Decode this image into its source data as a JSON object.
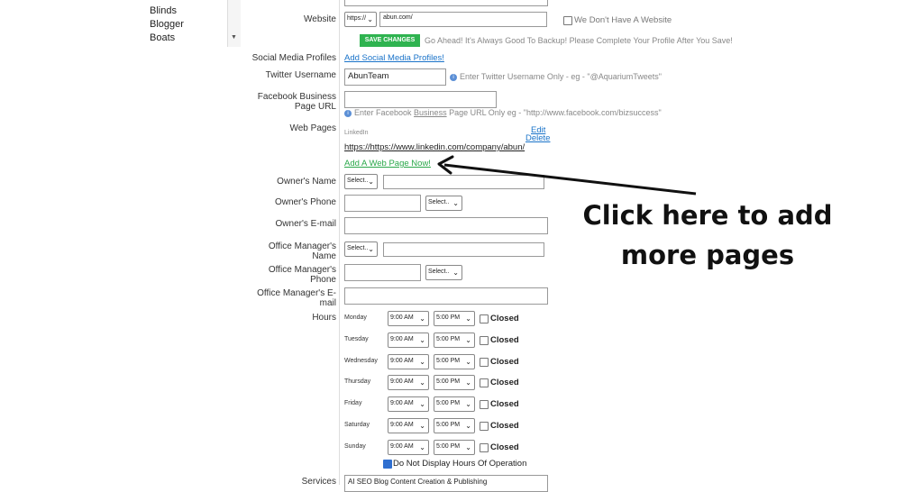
{
  "sidebar": {
    "items": [
      "Blinds",
      "Blogger",
      "Boats"
    ]
  },
  "form": {
    "website": {
      "label": "Website",
      "protocol": "https://",
      "value": "abun.com/",
      "no_website": "We Don't Have A Website"
    },
    "save": {
      "label": "SAVE CHANGES",
      "note": "Go Ahead!  It's Always Good To Backup!  Please Complete Your Profile After You Save!"
    },
    "social": {
      "label": "Social Media Profiles",
      "link": "Add Social Media Profiles!"
    },
    "twitter": {
      "label": "Twitter Username",
      "value": "AbunTeam",
      "hint": "Enter Twitter Username Only - eg - \"@AquariumTweets\""
    },
    "facebook": {
      "label_line1": "Facebook Business",
      "label_line2": "Page URL",
      "value": "",
      "hint_pre": "Enter Facebook ",
      "hint_u": "Business",
      "hint_post": " Page URL Only eg - \"http://www.facebook.com/bizsuccess\""
    },
    "web_pages": {
      "label": "Web Pages",
      "entry_title": "LinkedIn",
      "entry_url": "https://https://www.linkedin.com/company/abun/",
      "edit": "Edit",
      "delete": "Delete",
      "add": "Add A Web Page Now!"
    },
    "owner_name": {
      "label": "Owner's Name",
      "select": "Select..",
      "value": ""
    },
    "owner_phone": {
      "label": "Owner's Phone",
      "select": "Select..",
      "value": ""
    },
    "owner_email": {
      "label": "Owner's E-mail",
      "value": ""
    },
    "manager_name": {
      "label_line1": "Office Manager's",
      "label_line2": "Name",
      "select": "Select..",
      "value": ""
    },
    "manager_phone": {
      "label_line1": "Office Manager's",
      "label_line2": "Phone",
      "select": "Select..",
      "value": ""
    },
    "manager_email": {
      "label_line1": "Office Manager's E-",
      "label_line2": "mail",
      "value": ""
    },
    "hours": {
      "label": "Hours",
      "closed_label": "Closed",
      "days": [
        {
          "day": "Monday",
          "open": "9:00 AM",
          "close": "5:00 PM"
        },
        {
          "day": "Tuesday",
          "open": "9:00 AM",
          "close": "5:00 PM"
        },
        {
          "day": "Wednesday",
          "open": "9:00 AM",
          "close": "5:00 PM"
        },
        {
          "day": "Thursday",
          "open": "9:00 AM",
          "close": "5:00 PM"
        },
        {
          "day": "Friday",
          "open": "9:00 AM",
          "close": "5:00 PM"
        },
        {
          "day": "Saturday",
          "open": "9:00 AM",
          "close": "5:00 PM"
        },
        {
          "day": "Sunday",
          "open": "9:00 AM",
          "close": "5:00 PM"
        }
      ],
      "no_display": "Do Not Display Hours Of Operation"
    },
    "services": {
      "label": "Services",
      "value": "AI SEO Blog Content Creation & Publishing"
    }
  },
  "annotation": {
    "line1": "Click here to add",
    "line2": "more pages"
  }
}
